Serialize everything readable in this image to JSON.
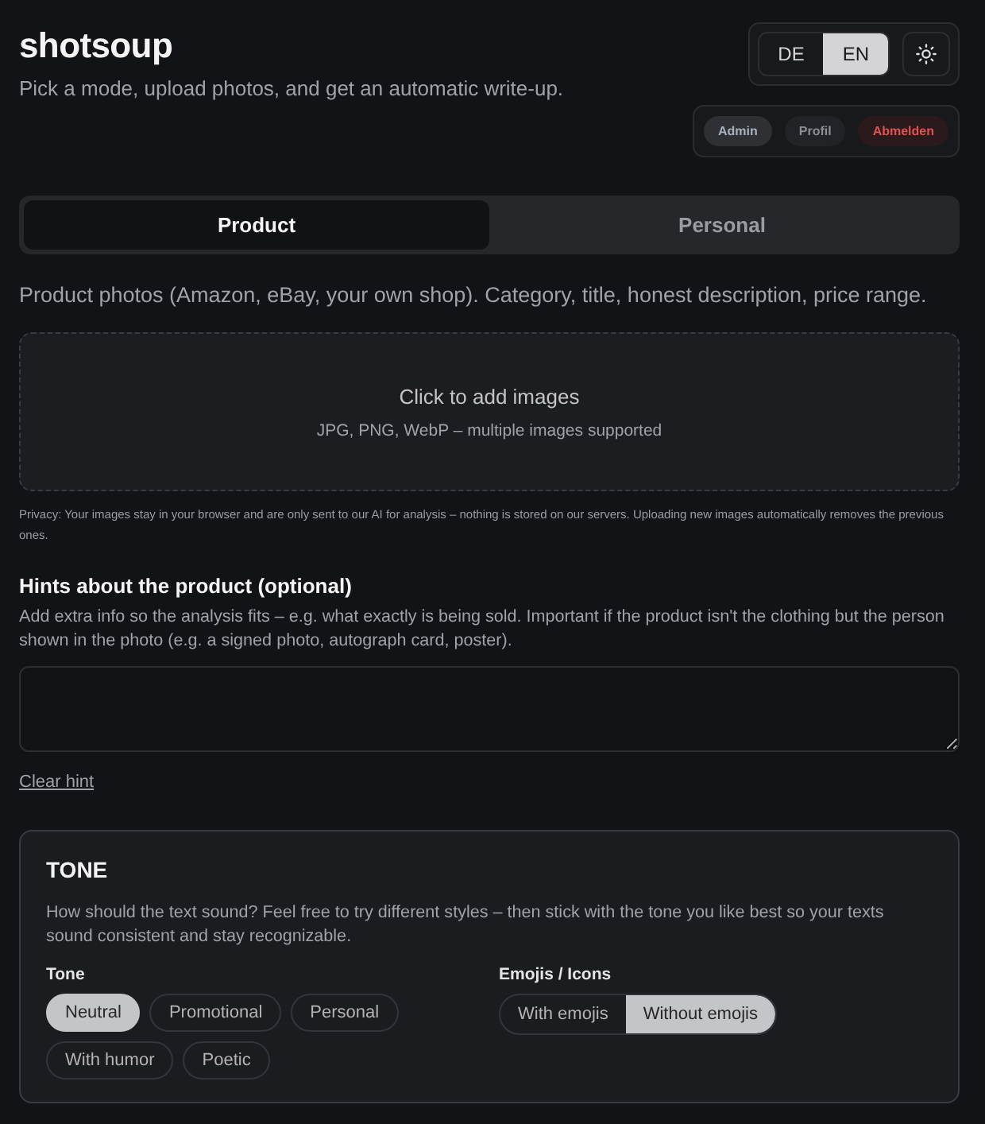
{
  "header": {
    "title": "shotsoup",
    "subtitle": "Pick a mode, upload photos, and get an automatic write-up."
  },
  "languages": [
    {
      "label": "DE",
      "selected": false
    },
    {
      "label": "EN",
      "selected": true
    }
  ],
  "account": [
    {
      "label": "Admin",
      "kind": "admin"
    },
    {
      "label": "Profil",
      "kind": "profile"
    },
    {
      "label": "Abmelden",
      "kind": "logout"
    }
  ],
  "tabs": [
    {
      "label": "Product",
      "selected": true
    },
    {
      "label": "Personal",
      "selected": false
    }
  ],
  "description": "Product photos (Amazon, eBay, your own shop). Category, title, honest description, price range.",
  "upload": {
    "title": "Click to add images",
    "hint": "JPG, PNG, WebP – multiple images supported"
  },
  "privacy": "Privacy: Your images stay in your browser and are only sent to our AI for analysis – nothing is stored on our servers. Uploading new images automatically removes the previous ones.",
  "hints": {
    "heading": "Hints about the product (optional)",
    "text": "Add extra info so the analysis fits – e.g. what exactly is being sold. Important if the product isn't the clothing but the person shown in the photo (e.g. a signed photo, autograph card, poster).",
    "clear": "Clear hint"
  },
  "tone": {
    "heading": "TONE",
    "text": "How should the text sound? Feel free to try different styles – then stick with the tone you like best so your texts sound consistent and stay recognizable.",
    "tone_label": "Tone",
    "tone_options": [
      {
        "label": "Neutral",
        "selected": true
      },
      {
        "label": "Promotional",
        "selected": false
      },
      {
        "label": "Personal",
        "selected": false
      },
      {
        "label": "With humor",
        "selected": false
      },
      {
        "label": "Poetic",
        "selected": false
      }
    ],
    "emoji_label": "Emojis / Icons",
    "emoji_options": [
      {
        "label": "With emojis",
        "selected": false
      },
      {
        "label": "Without emojis",
        "selected": true
      }
    ]
  }
}
